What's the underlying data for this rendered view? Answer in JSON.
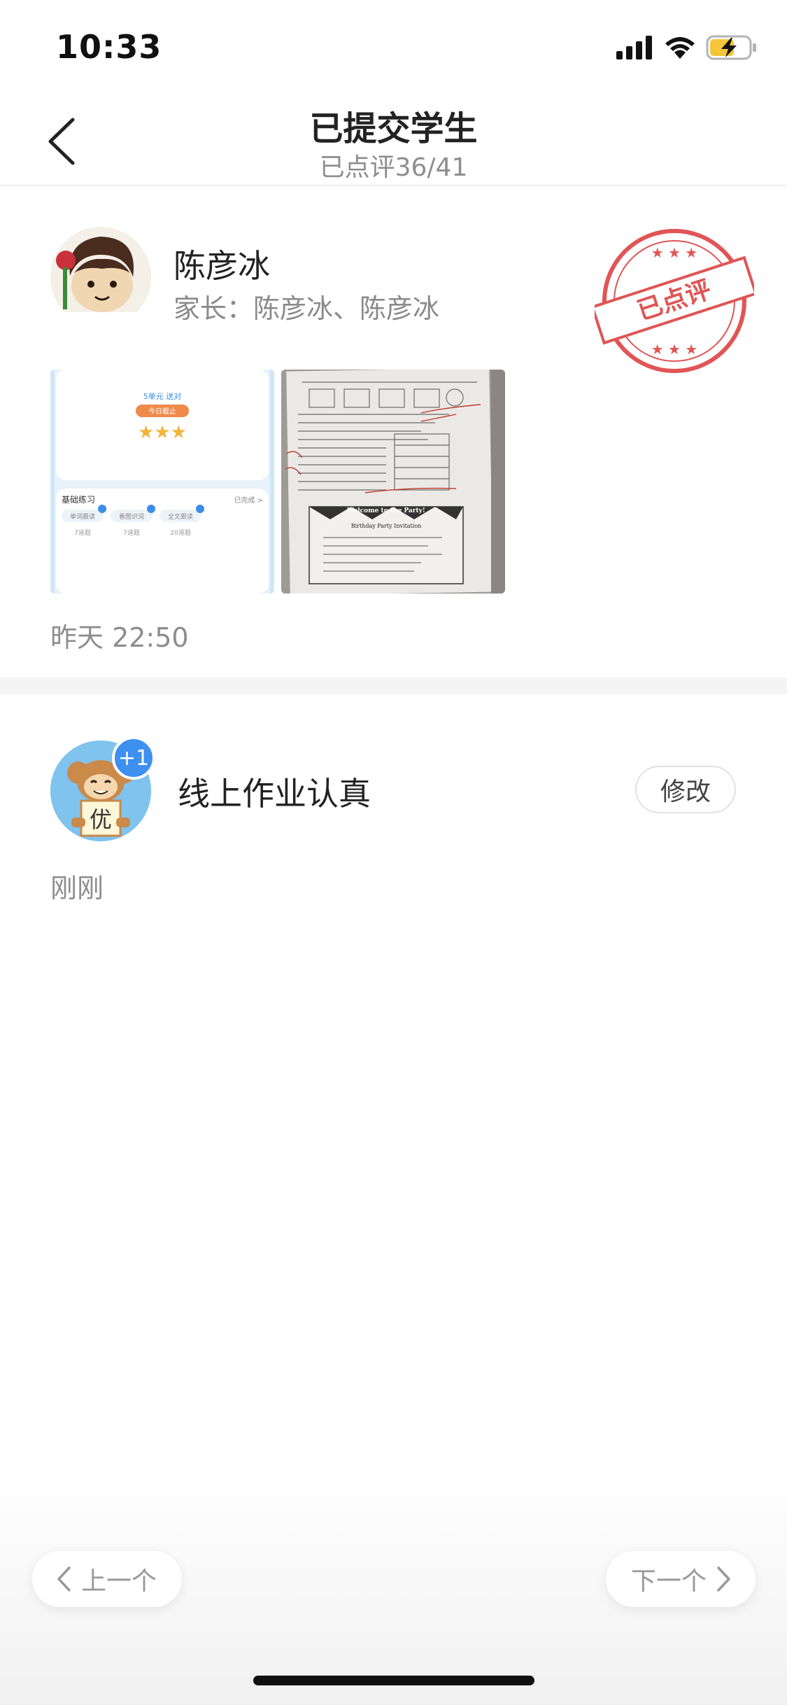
{
  "status_bar": {
    "time": "10:33",
    "icons": [
      "signal-icon",
      "wifi-icon",
      "battery-charging-icon"
    ]
  },
  "nav": {
    "title": "已提交学生",
    "subtitle": "已点评36/41",
    "back_icon": "chevron-left-icon"
  },
  "submission": {
    "student_name": "陈彦冰",
    "parent_line": "家长：陈彦冰、陈彦冰",
    "stamp_text": "已点评",
    "stamp_color": "#e05555",
    "submitted_time": "昨天 22:50",
    "thumb1": {
      "unit": "5单元 送对",
      "badge": "今日截止",
      "stars": "★★★",
      "section_title": "基础练习",
      "section_status": "已完成 >",
      "item1": "单词跟读",
      "item2": "看图识词",
      "item3": "全文跟读",
      "count1": "7道题",
      "count2": "7道题",
      "count3": "20道题"
    },
    "thumb2": {
      "heading": "Welcome to the Party!",
      "subheading": "Birthday Party Invitation"
    }
  },
  "review": {
    "badge": "+1",
    "avatar_char": "优",
    "title": "线上作业认真",
    "edit_label": "修改",
    "time": "刚刚"
  },
  "pager": {
    "prev_label": "上一个",
    "next_label": "下一个"
  },
  "colors": {
    "accent_blue": "#3d8ff0",
    "secondary_text": "#8d8d8d",
    "stamp_red": "#e05555"
  }
}
